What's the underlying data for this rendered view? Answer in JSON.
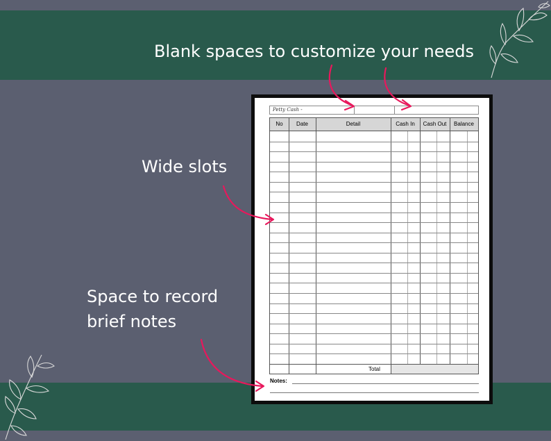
{
  "annotations": {
    "top": "Blank spaces to customize your needs",
    "middle": "Wide slots",
    "bottom_line1": "Space to record",
    "bottom_line2": "brief notes"
  },
  "sheet": {
    "title": "Petty Cash -",
    "columns": [
      "No",
      "Date",
      "Detail",
      "Cash In",
      "Cash Out",
      "Balance"
    ],
    "total_label": "Total",
    "notes_label": "Notes:"
  },
  "colors": {
    "background": "#5b5f70",
    "band": "#295a4c",
    "arrow": "#e8185c",
    "text": "#ffffff"
  },
  "icons": [
    "leaf-branch-icon",
    "leaf-branch-icon",
    "arrow-icon"
  ]
}
